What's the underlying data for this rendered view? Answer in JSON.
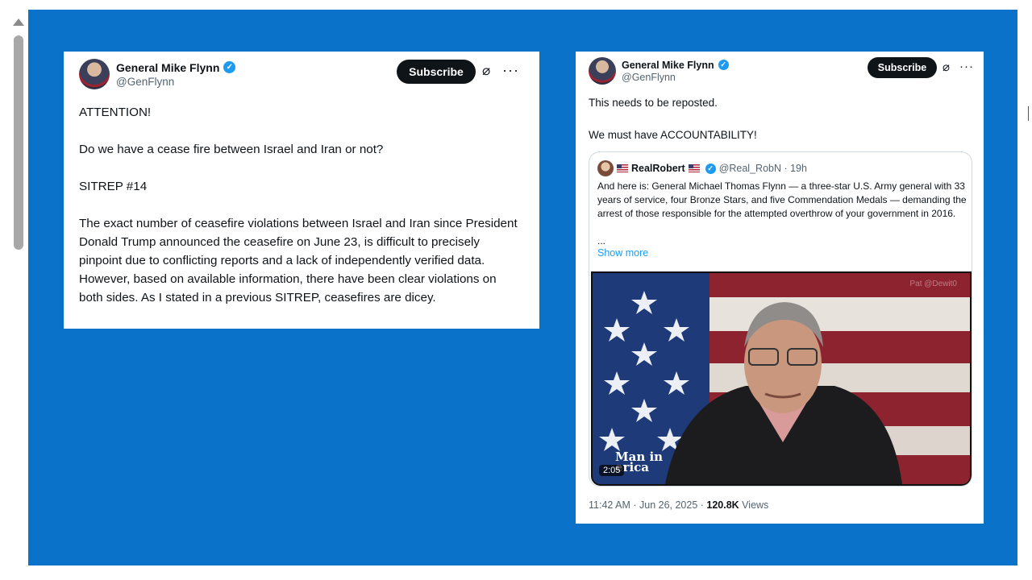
{
  "colors": {
    "background_blue": "#0a72c8",
    "verified": "#1d9bf0",
    "text": "#0f1419",
    "muted": "#536471"
  },
  "post1": {
    "author_name": "General Mike Flynn",
    "handle": "@GenFlynn",
    "subscribe_label": "Subscribe",
    "paragraphs": [
      "ATTENTION!",
      "Do we have a cease fire between Israel and Iran or not?",
      "SITREP #14",
      "The exact number of ceasefire violations between Israel and Iran since President Donald Trump announced the ceasefire on June 23, is difficult to precisely pinpoint due to conflicting reports and a lack of independently verified data. However, based on available information, there have been clear violations on both sides. As I stated in a previous SITREP, ceasefires are dicey."
    ]
  },
  "post2": {
    "author_name": "General Mike Flynn",
    "handle": "@GenFlynn",
    "subscribe_label": "Subscribe",
    "paragraphs": [
      "This needs to be reposted.",
      "We must have ACCOUNTABILITY!"
    ],
    "quote": {
      "author_name": "RealRobert",
      "handle_time": "@Real_RobN · 19h",
      "text": "And here is: General Michael Thomas Flynn — a three-star U.S. Army general with 33 years of service, four Bronze Stars, and five Commendation Medals — demanding the arrest of those responsible for the attempted overthrow of your government in 2016.",
      "ellipsis": "...",
      "show_more": "Show more",
      "video": {
        "duration": "2:05",
        "watermark_line1": "Man in",
        "watermark_line2": "erica",
        "corner_watermark": "Pat @Dewit0"
      }
    },
    "timestamp": "11:42 AM · Jun 26, 2025 · ",
    "views_count": "120.8K",
    "views_label": " Views"
  },
  "icons": {
    "grok": "grok-icon",
    "more": "more-icon",
    "verified": "verified-icon",
    "scroll_up": "scroll-up-icon"
  }
}
